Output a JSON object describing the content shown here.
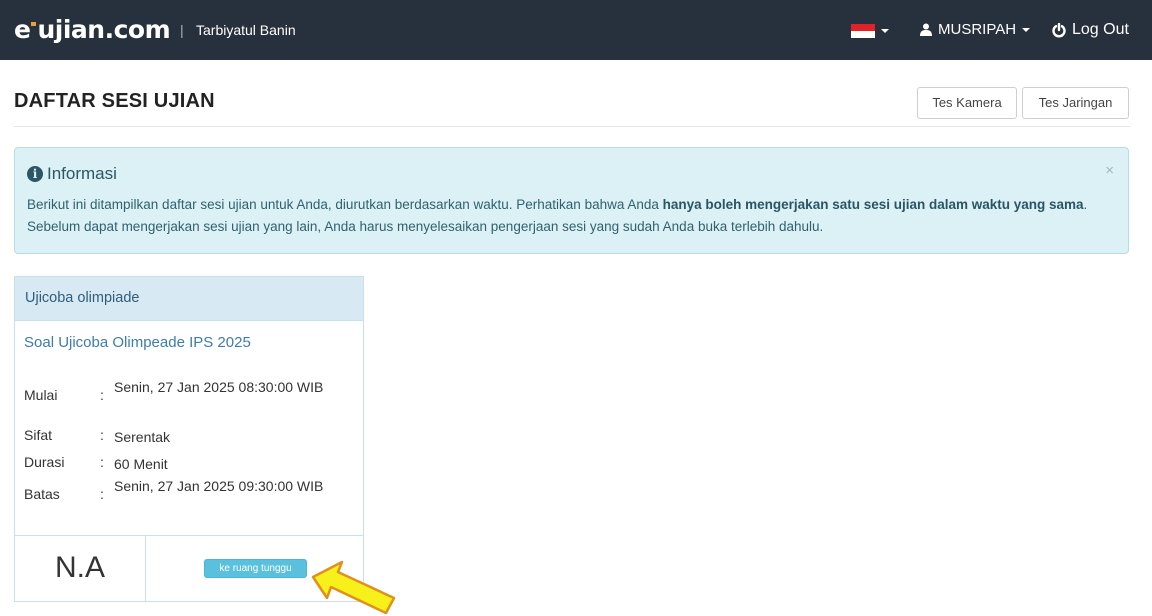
{
  "navbar": {
    "brand_prefix": "e",
    "brand_main": "ujian.com",
    "separator": "|",
    "school": "Tarbiyatul Banin",
    "user": "MUSRIPAH",
    "logout": "Log Out"
  },
  "page": {
    "title": "DAFTAR SESI UJIAN",
    "btn_kamera": "Tes Kamera",
    "btn_jaringan": "Tes Jaringan"
  },
  "alert": {
    "title": "Informasi",
    "close": "×",
    "text_1": "Berikut ini ditampilkan daftar sesi ujian untuk Anda, diurutkan berdasarkan waktu. Perhatikan bahwa Anda ",
    "text_bold": "hanya boleh mengerjakan satu sesi ujian dalam waktu yang sama",
    "text_2": ". Sebelum dapat mengerjakan sesi ujian yang lain, Anda harus menyelesaikan pengerjaan sesi yang sudah Anda buka terlebih dahulu."
  },
  "card": {
    "header": "Ujicoba olimpiade",
    "subtitle": "Soal Ujicoba Olimpeade IPS 2025",
    "rows": [
      {
        "label": "Mulai",
        "colon": ":",
        "value": "Senin, 27 Jan 2025 08:30:00 WIB"
      },
      {
        "label": "Sifat",
        "colon": ":",
        "value": "Serentak"
      },
      {
        "label": "Durasi",
        "colon": ":",
        "value": "60 Menit"
      },
      {
        "label": "Batas",
        "colon": ":",
        "value": "Senin, 27 Jan 2025 09:30:00 WIB"
      }
    ],
    "score": "N.A",
    "button": "ke ruang tunggu"
  },
  "icons": {
    "flag": "indonesia-flag",
    "user": "user-icon",
    "logout": "power-icon",
    "info": "info-circle-icon",
    "arrow": "pointer-arrow"
  },
  "colors": {
    "navbar": "#27303d",
    "brand_accent": "#e9a03b",
    "alert_bg": "#dbf1f5",
    "card_head_bg": "#d7eaf4",
    "link": "#3c7cb0",
    "info_button": "#5bc0de",
    "arrow_fill": "#f7f01a",
    "arrow_stroke": "#e0901c"
  }
}
